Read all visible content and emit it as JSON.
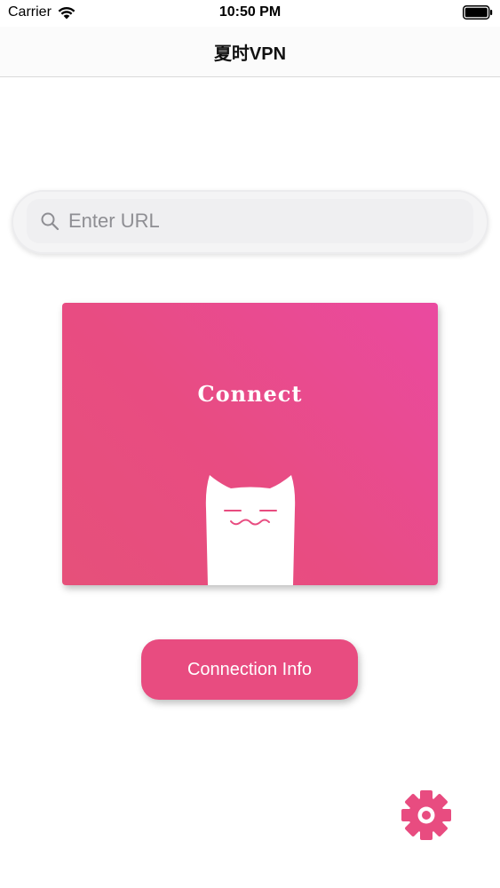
{
  "status_bar": {
    "carrier": "Carrier",
    "time": "10:50 PM"
  },
  "nav": {
    "title": "夏时VPN"
  },
  "search": {
    "placeholder": "Enter URL",
    "value": ""
  },
  "connect_card": {
    "label": "Connect"
  },
  "info_button": {
    "label": "Connection Info"
  },
  "icons": {
    "wifi": "wifi-icon",
    "battery": "battery-icon",
    "search": "search-icon",
    "mascot": "cat-mascot",
    "settings": "gear-icon"
  },
  "colors": {
    "accent": "#e84c80",
    "card_gradient_start": "#ea4aa0",
    "card_gradient_end": "#e6507a",
    "placeholder": "#8e8e93"
  }
}
